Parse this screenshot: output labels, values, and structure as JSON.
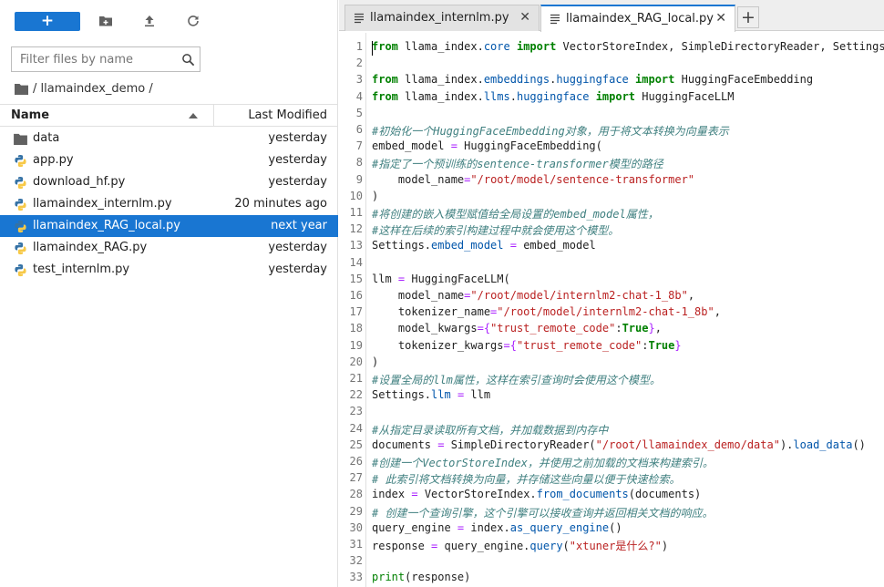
{
  "file_browser": {
    "new_button_label": "+",
    "filter_placeholder": "Filter files by name",
    "breadcrumb": "/ llamaindex_demo /",
    "columns": {
      "name": "Name",
      "modified": "Last Modified"
    },
    "files": [
      {
        "name": "data",
        "modified": "yesterday",
        "icon": "folder-icon",
        "selected": false
      },
      {
        "name": "app.py",
        "modified": "yesterday",
        "icon": "python-icon",
        "selected": false
      },
      {
        "name": "download_hf.py",
        "modified": "yesterday",
        "icon": "python-icon",
        "selected": false
      },
      {
        "name": "llamaindex_internlm.py",
        "modified": "20 minutes ago",
        "icon": "python-icon",
        "selected": false
      },
      {
        "name": "llamaindex_RAG_local.py",
        "modified": "next year",
        "icon": "python-icon",
        "selected": true
      },
      {
        "name": "llamaindex_RAG.py",
        "modified": "yesterday",
        "icon": "python-icon",
        "selected": false
      },
      {
        "name": "test_internlm.py",
        "modified": "yesterday",
        "icon": "python-icon",
        "selected": false
      }
    ]
  },
  "editor": {
    "tabs": [
      {
        "label": "llamaindex_internlm.py",
        "active": false
      },
      {
        "label": "llamaindex_RAG_local.py",
        "active": true
      }
    ],
    "tab_add_label": "+",
    "tab_close_label": "✕",
    "code_lines": [
      "from llama_index.core import VectorStoreIndex, SimpleDirectoryReader, Settings",
      "",
      "from llama_index.embeddings.huggingface import HuggingFaceEmbedding",
      "from llama_index.llms.huggingface import HuggingFaceLLM",
      "",
      "#初始化一个HuggingFaceEmbedding对象，用于将文本转换为向量表示",
      "embed_model = HuggingFaceEmbedding(",
      "#指定了一个预训练的sentence-transformer模型的路径",
      "    model_name=\"/root/model/sentence-transformer\"",
      ")",
      "#将创建的嵌入模型赋值给全局设置的embed_model属性，",
      "#这样在后续的索引构建过程中就会使用这个模型。",
      "Settings.embed_model = embed_model",
      "",
      "llm = HuggingFaceLLM(",
      "    model_name=\"/root/model/internlm2-chat-1_8b\",",
      "    tokenizer_name=\"/root/model/internlm2-chat-1_8b\",",
      "    model_kwargs={\"trust_remote_code\":True},",
      "    tokenizer_kwargs={\"trust_remote_code\":True}",
      ")",
      "#设置全局的llm属性，这样在索引查询时会使用这个模型。",
      "Settings.llm = llm",
      "",
      "#从指定目录读取所有文档，并加载数据到内存中",
      "documents = SimpleDirectoryReader(\"/root/llamaindex_demo/data\").load_data()",
      "#创建一个VectorStoreIndex，并使用之前加载的文档来构建索引。",
      "# 此索引将文档转换为向量，并存储这些向量以便于快速检索。",
      "index = VectorStoreIndex.from_documents(documents)",
      "# 创建一个查询引擎，这个引擎可以接收查询并返回相关文档的响应。",
      "query_engine = index.as_query_engine()",
      "response = query_engine.query(\"xtuner是什么?\")",
      "",
      "print(response)"
    ]
  }
}
